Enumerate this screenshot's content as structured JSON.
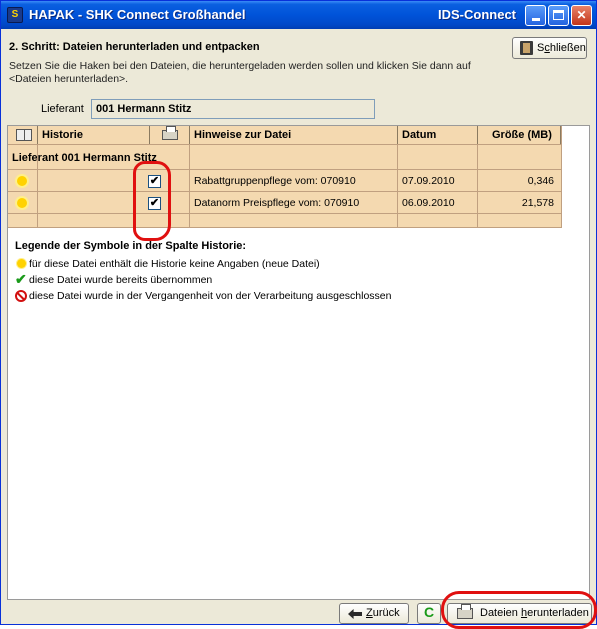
{
  "window": {
    "title": "HAPAK - SHK Connect Großhandel",
    "title_right": "IDS-Connect",
    "min_icon": "minimize-icon",
    "max_icon": "maximize-icon",
    "close_icon": "close-icon"
  },
  "step": {
    "title": "2. Schritt: Dateien herunterladen und entpacken",
    "description": "Setzen Sie die Haken bei den Dateien, die heruntergeladen werden sollen und klicken Sie dann auf <Dateien herunterladen>.",
    "close_button": {
      "prefix": "S",
      "underlined": "c",
      "suffix": "hließen",
      "icon": "door-icon"
    }
  },
  "lieferant": {
    "label": "Lieferant",
    "value": "001 Hermann Stitz"
  },
  "grid": {
    "columns": {
      "historie": "Historie",
      "hinweise": "Hinweise zur Datei",
      "datum": "Datum",
      "groesse": "Größe (MB)"
    },
    "group": "Lieferant 001 Hermann Stitz",
    "rows": [
      {
        "icon": "new-file-sun-icon",
        "checked": true,
        "check_glyph": "✔",
        "hinweise": "Rabattgruppenpflege vom: 070910",
        "datum": "07.09.2010",
        "groesse": "0,346"
      },
      {
        "icon": "new-file-sun-icon",
        "checked": true,
        "check_glyph": "✔",
        "hinweise": "Datanorm Preispflege vom: 070910",
        "datum": "06.09.2010",
        "groesse": "21,578"
      }
    ]
  },
  "legend": {
    "title": "Legende der Symbole in der Spalte Historie:",
    "items": [
      {
        "icon": "sun-icon",
        "text": "für diese Datei enthält die Historie keine Angaben (neue Datei)"
      },
      {
        "icon": "check-icon",
        "text": "diese Datei wurde bereits übernommen"
      },
      {
        "icon": "ban-icon",
        "text": "diese Datei wurde in der Vergangenheit von der Verarbeitung ausgeschlossen"
      }
    ]
  },
  "bottom": {
    "back": {
      "underlined": "Z",
      "suffix": "urück"
    },
    "refresh_glyph": "C",
    "download": {
      "prefix": "Dateien ",
      "underlined": "h",
      "suffix": "erunterladen"
    }
  },
  "colors": {
    "titlebar": "#0053d9",
    "grid_row": "#f4d9b0",
    "annotation_red": "#e01010"
  }
}
